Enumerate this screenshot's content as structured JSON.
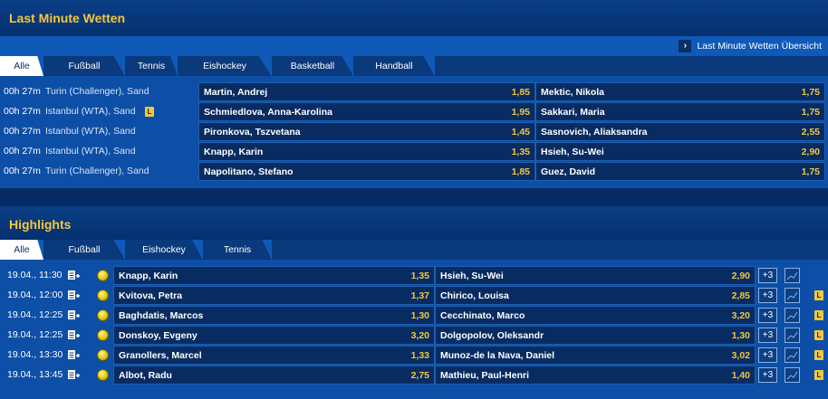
{
  "last_minute": {
    "title": "Last Minute Wetten",
    "overview_link": "Last Minute Wetten Übersicht",
    "tabs": [
      "Alle",
      "Fußball",
      "Tennis",
      "Eishockey",
      "Basketball",
      "Handball"
    ],
    "rows": [
      {
        "time": "00h 27m",
        "league": "Turin (Challenger), Sand",
        "live": false,
        "home": "Martin, Andrej",
        "home_odd": "1,85",
        "away": "Mektic, Nikola",
        "away_odd": "1,75"
      },
      {
        "time": "00h 27m",
        "league": "Istanbul (WTA), Sand",
        "live": true,
        "home": "Schmiedlova, Anna-Karolina",
        "home_odd": "1,95",
        "away": "Sakkari, Maria",
        "away_odd": "1,75"
      },
      {
        "time": "00h 27m",
        "league": "Istanbul (WTA), Sand",
        "live": false,
        "home": "Pironkova, Tszvetana",
        "home_odd": "1,45",
        "away": "Sasnovich, Aliaksandra",
        "away_odd": "2,55"
      },
      {
        "time": "00h 27m",
        "league": "Istanbul (WTA), Sand",
        "live": false,
        "home": "Knapp, Karin",
        "home_odd": "1,35",
        "away": "Hsieh, Su-Wei",
        "away_odd": "2,90"
      },
      {
        "time": "00h 27m",
        "league": "Turin (Challenger), Sand",
        "live": false,
        "home": "Napolitano, Stefano",
        "home_odd": "1,85",
        "away": "Guez, David",
        "away_odd": "1,75"
      }
    ]
  },
  "highlights": {
    "title": "Highlights",
    "tabs": [
      "Alle",
      "Fußball",
      "Eishockey",
      "Tennis"
    ],
    "live_badge": "L",
    "rows": [
      {
        "date": "19.04., 11:30",
        "home": "Knapp, Karin",
        "home_odd": "1,35",
        "away": "Hsieh, Su-Wei",
        "away_odd": "2,90",
        "more": "+3",
        "live": false
      },
      {
        "date": "19.04., 12:00",
        "home": "Kvitova, Petra",
        "home_odd": "1,37",
        "away": "Chirico, Louisa",
        "away_odd": "2,85",
        "more": "+3",
        "live": true
      },
      {
        "date": "19.04., 12:25",
        "home": "Baghdatis, Marcos",
        "home_odd": "1,30",
        "away": "Cecchinato, Marco",
        "away_odd": "3,20",
        "more": "+3",
        "live": true
      },
      {
        "date": "19.04., 12:25",
        "home": "Donskoy, Evgeny",
        "home_odd": "3,20",
        "away": "Dolgopolov, Oleksandr",
        "away_odd": "1,30",
        "more": "+3",
        "live": true
      },
      {
        "date": "19.04., 13:30",
        "home": "Granollers, Marcel",
        "home_odd": "1,33",
        "away": "Munoz-de la Nava, Daniel",
        "away_odd": "3,02",
        "more": "+3",
        "live": true
      },
      {
        "date": "19.04., 13:45",
        "home": "Albot, Radu",
        "home_odd": "2,75",
        "away": "Mathieu, Paul-Henri",
        "away_odd": "1,40",
        "more": "+3",
        "live": true
      }
    ]
  },
  "colors": {
    "accent": "#f3c63c",
    "bg": "#062a63",
    "tab_bar": "#0f59b8"
  }
}
